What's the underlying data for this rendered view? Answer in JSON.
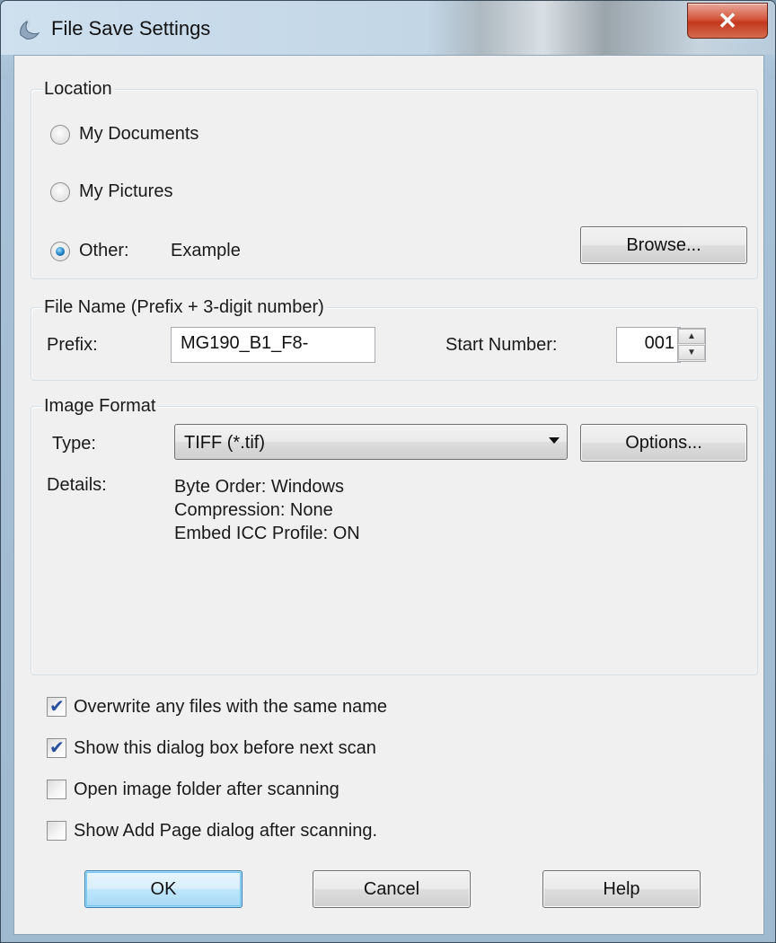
{
  "window": {
    "title": "File Save Settings",
    "close_icon": "close-icon",
    "close_glyph": "✕"
  },
  "location": {
    "group_label": "Location",
    "options": [
      {
        "label": "My Documents",
        "checked": false
      },
      {
        "label": "My Pictures",
        "checked": false
      },
      {
        "label": "Other:",
        "checked": true
      }
    ],
    "other_value": "Example",
    "browse_label": "Browse..."
  },
  "file_name": {
    "group_label": "File Name (Prefix + 3-digit number)",
    "prefix_label": "Prefix:",
    "prefix_value": "MG190_B1_F8-",
    "start_number_label": "Start Number:",
    "start_number_value": "001"
  },
  "image_format": {
    "group_label": "Image Format",
    "type_label": "Type:",
    "type_value": "TIFF (*.tif)",
    "options_label": "Options...",
    "details_label": "Details:",
    "details_lines": [
      "Byte Order: Windows",
      "Compression: None",
      "Embed ICC Profile: ON"
    ]
  },
  "checkboxes": [
    {
      "label": "Overwrite any files with the same name",
      "checked": true
    },
    {
      "label": "Show this dialog box before next scan",
      "checked": true
    },
    {
      "label": "Open image folder after scanning",
      "checked": false
    },
    {
      "label": "Show Add Page dialog after scanning.",
      "checked": false
    }
  ],
  "buttons": {
    "ok": "OK",
    "cancel": "Cancel",
    "help": "Help"
  }
}
